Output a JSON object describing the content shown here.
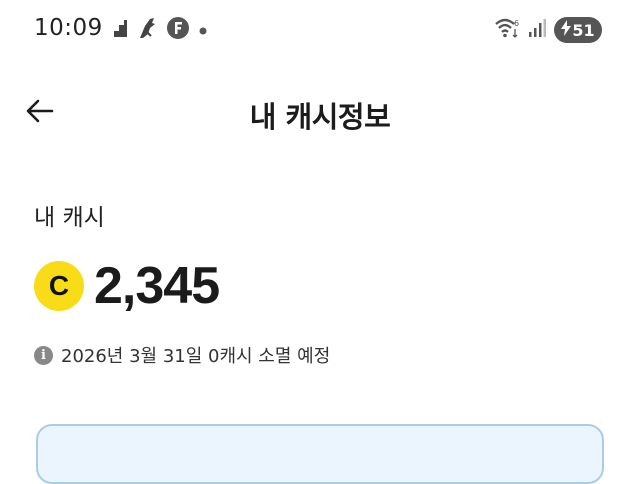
{
  "status_bar": {
    "time": "10:09",
    "left_icons": [
      "stairs-icon",
      "bird-icon",
      "app-f-icon",
      "dot-icon"
    ],
    "right_icons": [
      "wifi-icon",
      "signal-icon"
    ],
    "battery": "51"
  },
  "header": {
    "back_icon": "arrow-left-icon",
    "title": "내 캐시정보"
  },
  "cash": {
    "label": "내 캐시",
    "coin_letter": "C",
    "amount": "2,345",
    "expire_text": "2026년 3월 31일 0캐시 소멸 예정"
  },
  "colors": {
    "coin": "#f8dc17",
    "card_bg": "#eaf5fd",
    "card_border": "#a9cde9"
  }
}
